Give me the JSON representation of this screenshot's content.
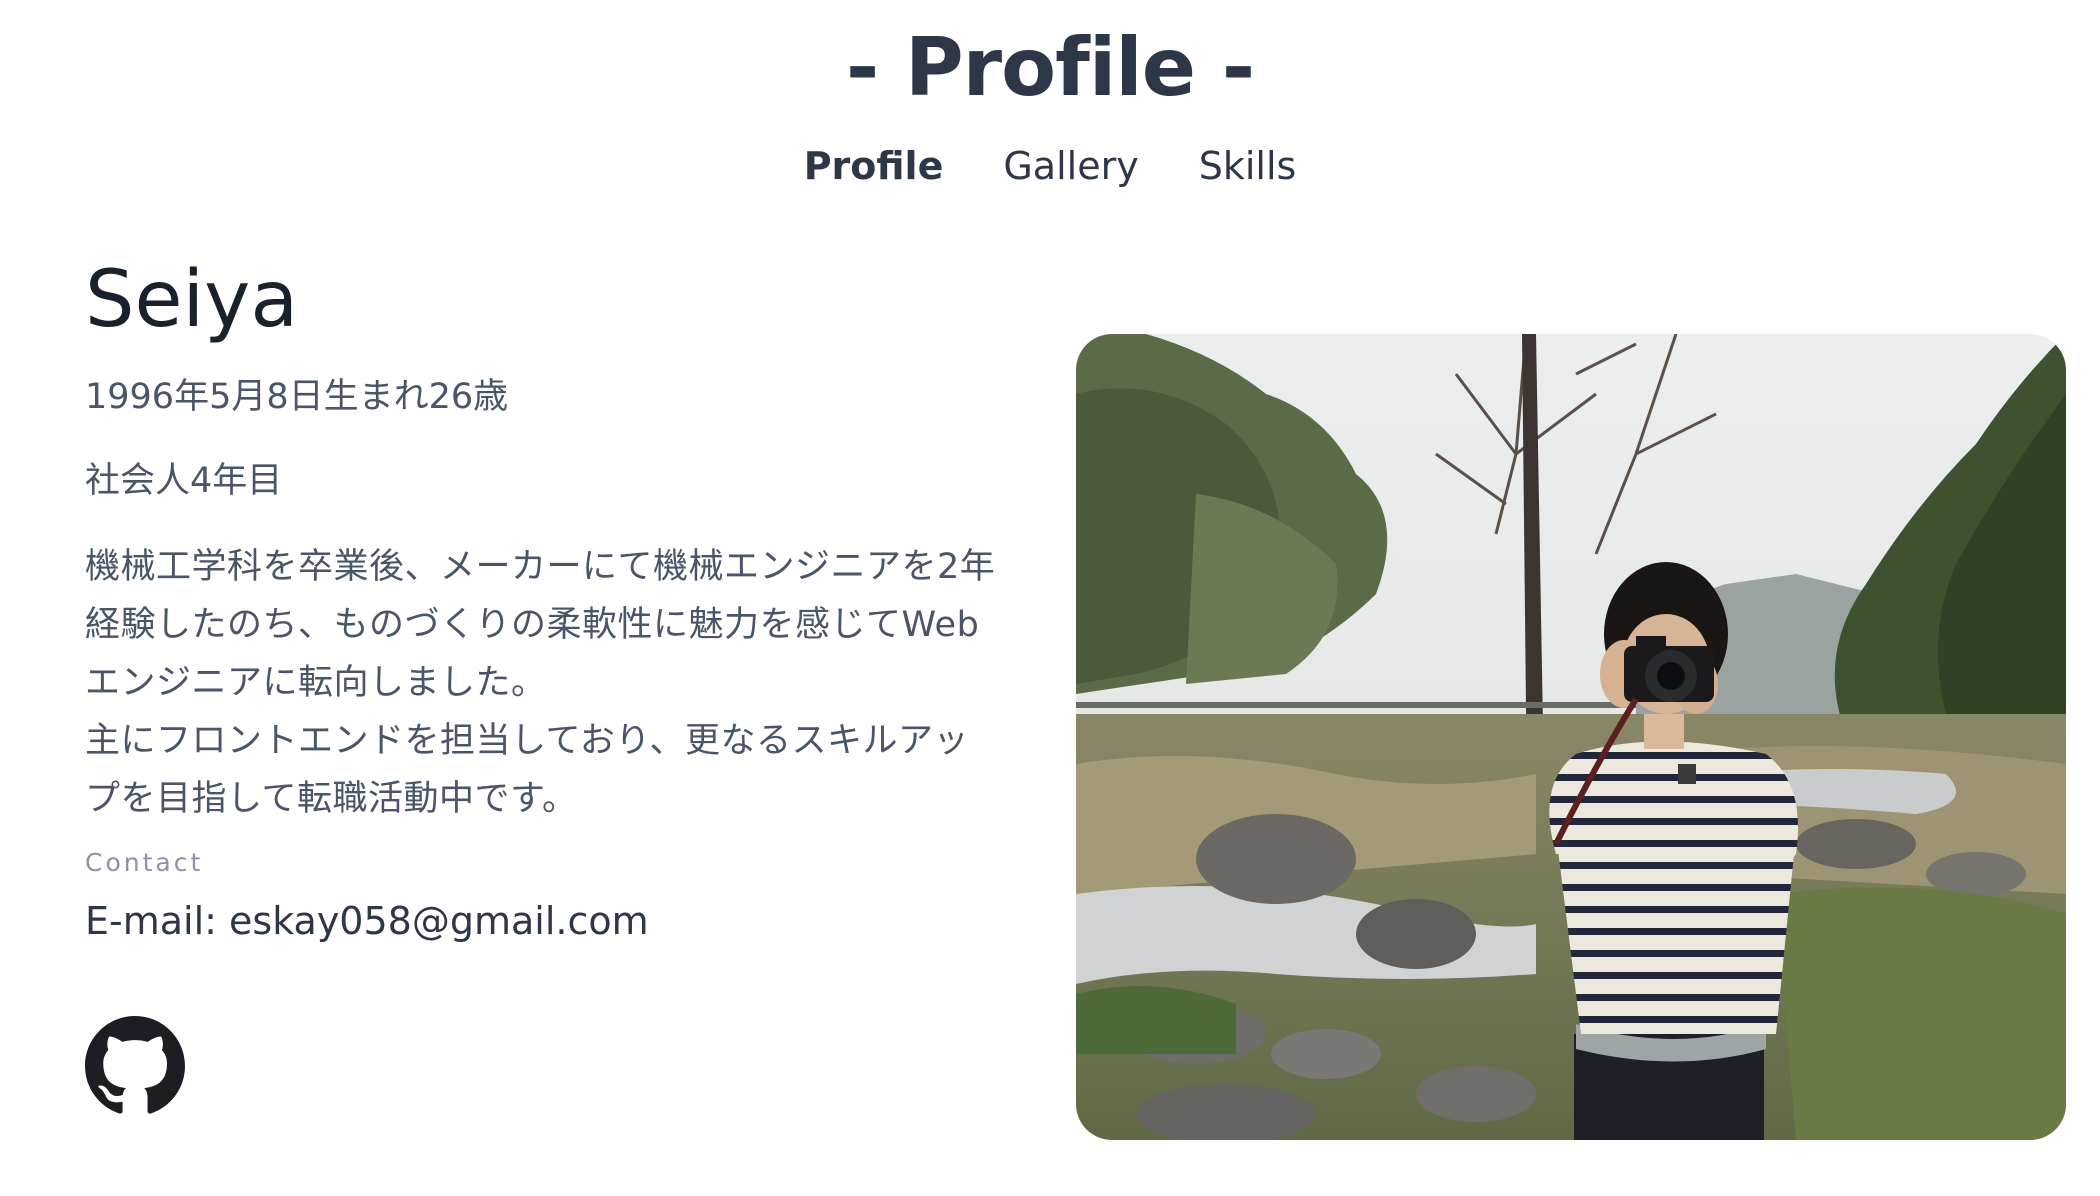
{
  "header": {
    "title": "- Profile -"
  },
  "nav": {
    "items": [
      {
        "label": "Profile",
        "active": true
      },
      {
        "label": "Gallery",
        "active": false
      },
      {
        "label": "Skills",
        "active": false
      }
    ]
  },
  "profile": {
    "name": "Seiya",
    "birth": "1996年5月8日生まれ26歳",
    "career": "社会人4年目",
    "bio": "機械工学科を卒業後、メーカーにて機械エンジニアを2年\n経験したのち、ものづくりの柔軟性に魅力を感じてWeb\nエンジニアに転向しました。\n主にフロントエンドを担当しており、更なるスキルアッ\nプを目指して転職活動中です。",
    "contact_label": "Contact",
    "email": "E-mail: eskay058@gmail.com"
  },
  "icons": {
    "github": "github-icon"
  },
  "photo": {
    "subject": "person-with-camera-photo"
  }
}
